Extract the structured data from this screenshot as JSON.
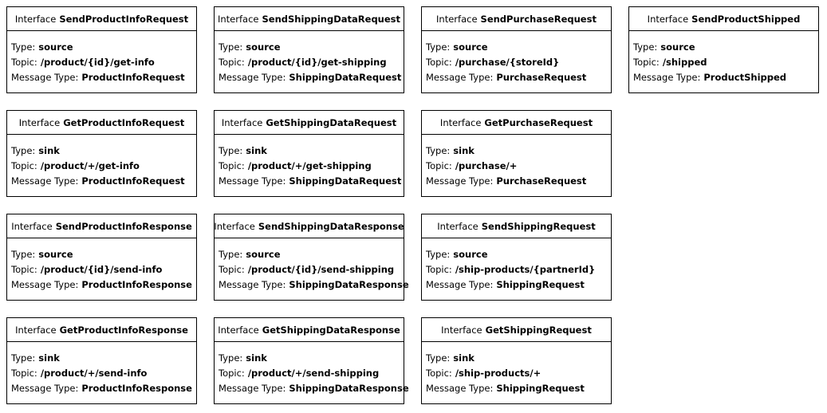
{
  "labels": {
    "interface": "Interface",
    "type": "Type:",
    "topic": "Topic:",
    "message_type": "Message Type:"
  },
  "interfaces": [
    {
      "name": "SendProductInfoRequest",
      "type": "source",
      "topic": "/product/{id}/get-info",
      "message_type": "ProductInfoRequest"
    },
    {
      "name": "SendShippingDataRequest",
      "type": "source",
      "topic": "/product/{id}/get-shipping",
      "message_type": "ShippingDataRequest"
    },
    {
      "name": "SendPurchaseRequest",
      "type": "source",
      "topic": "/purchase/{storeId}",
      "message_type": "PurchaseRequest"
    },
    {
      "name": "SendProductShipped",
      "type": "source",
      "topic": "/shipped",
      "message_type": "ProductShipped"
    },
    {
      "name": "GetProductInfoRequest",
      "type": "sink",
      "topic": "/product/+/get-info",
      "message_type": "ProductInfoRequest"
    },
    {
      "name": "GetShippingDataRequest",
      "type": "sink",
      "topic": "/product/+/get-shipping",
      "message_type": "ShippingDataRequest"
    },
    {
      "name": "GetPurchaseRequest",
      "type": "sink",
      "topic": "/purchase/+",
      "message_type": "PurchaseRequest"
    },
    {
      "name": "SendProductInfoResponse",
      "type": "source",
      "topic": "/product/{id}/send-info",
      "message_type": "ProductInfoResponse"
    },
    {
      "name": "SendShippingDataResponse",
      "type": "source",
      "topic": "/product/{id}/send-shipping",
      "message_type": "ShippingDataResponse"
    },
    {
      "name": "SendShippingRequest",
      "type": "source",
      "topic": "/ship-products/{partnerId}",
      "message_type": "ShippingRequest"
    },
    {
      "name": "GetProductInfoResponse",
      "type": "sink",
      "topic": "/product/+/send-info",
      "message_type": "ProductInfoResponse"
    },
    {
      "name": "GetShippingDataResponse",
      "type": "sink",
      "topic": "/product/+/send-shipping",
      "message_type": "ShippingDataResponse"
    },
    {
      "name": "GetShippingRequest",
      "type": "sink",
      "topic": "/ship-products/+",
      "message_type": "ShippingRequest"
    }
  ]
}
